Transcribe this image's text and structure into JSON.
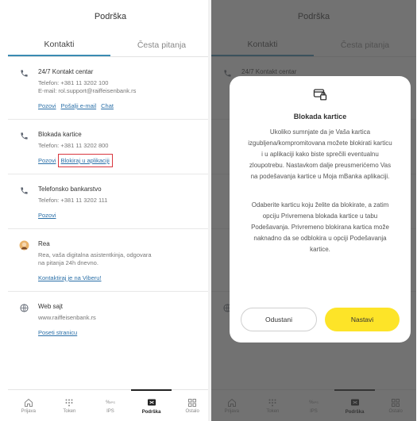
{
  "header": {
    "title": "Podrška"
  },
  "tabs": [
    {
      "label": "Kontakti"
    },
    {
      "label": "Česta pitanja"
    }
  ],
  "contacts": [
    {
      "title": "24/7 Kontakt centar",
      "lines": [
        "Telefon: +381 11 3202 100",
        "E-mail: rol.support@raiffeisenbank.rs"
      ],
      "links": [
        "Pozovi",
        "Pošalji e-mail",
        "Chat"
      ]
    },
    {
      "title": "Blokada kartice",
      "lines": [
        "Telefon: +381 11 3202 800"
      ],
      "links": [
        "Pozovi",
        "Blokiraj u aplikaciji"
      ]
    },
    {
      "title": "Telefonsko bankarstvo",
      "lines": [
        "Telefon: +381 11 3202 111"
      ],
      "links": [
        "Pozovi"
      ]
    },
    {
      "title": "Rea",
      "lines": [
        "Rea, vaša digitalna asistentkinja, odgovara",
        "na pitanja 24h dnevno."
      ],
      "links": [
        "Kontaktiraj je na Viberu!"
      ]
    },
    {
      "title": "Web sajt",
      "lines": [
        "www.raiffeisenbank.rs"
      ],
      "links": [
        "Poseti stranicu"
      ]
    }
  ],
  "bottom_nav": [
    {
      "label": "Prijava",
      "icon": "home-icon"
    },
    {
      "label": "Token",
      "icon": "token-icon"
    },
    {
      "label": "IPS",
      "icon": "ips-icon"
    },
    {
      "label": "Podrška",
      "icon": "support-icon"
    },
    {
      "label": "Ostalo",
      "icon": "grid-icon"
    }
  ],
  "modal": {
    "title": "Blokada kartice",
    "body1": "Ukoliko sumnjate da je Vaša kartica izgubljena/kompromitovana možete blokirati karticu i u aplikaciji kako biste sprečili eventualnu zloupotrebu. Nastavkom dalje preusmerićemo Vas na podešavanja kartice u Moja mBanka aplikaciji.",
    "body2": "Odaberite karticu koju želite da blokirate, a zatim opciju Privremena blokada kartice u tabu Podešavanja. Privremeno blokirana kartica može naknadno da se odblokira u opciji Podešavanja kartice.",
    "cancel": "Odustani",
    "confirm": "Nastavi"
  },
  "colors": {
    "accent": "#3a8bb2",
    "link": "#2b70a8",
    "confirm": "#fde428",
    "highlight_box": "#d9363e"
  }
}
